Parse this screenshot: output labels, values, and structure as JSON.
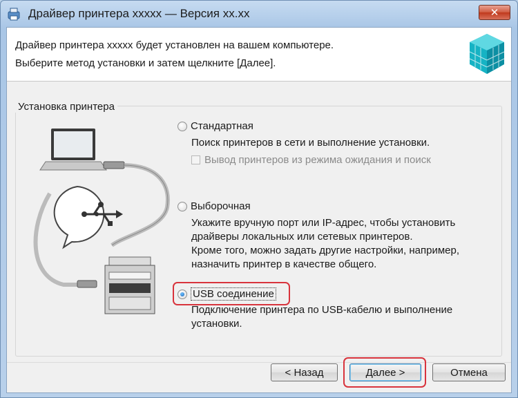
{
  "window": {
    "title": "Драйвер принтера xxxxx — Версия xx.xx",
    "close_glyph": "✕"
  },
  "header": {
    "line1": "Драйвер принтера xxxxx будет установлен на вашем компьютере.",
    "line2": "Выберите метод установки и затем щелкните [Далее]."
  },
  "group": {
    "label": "Установка принтера"
  },
  "options": [
    {
      "label": "Стандартная",
      "checked": false,
      "description": [
        "Поиск принтеров в сети и выполнение установки."
      ],
      "checkbox": {
        "label": "Вывод принтеров из режима ожидания и поиск",
        "checked": false,
        "enabled": false
      }
    },
    {
      "label": "Выборочная",
      "checked": false,
      "description": [
        "Укажите вручную порт или IP-адрес, чтобы установить",
        "драйверы локальных или сетевых принтеров.",
        "Кроме того, можно задать другие настройки, например,",
        "назначить принтер в качестве общего."
      ]
    },
    {
      "label": "USB соединение",
      "checked": true,
      "description": [
        "Подключение принтера по USB-кабелю и выполнение",
        "установки."
      ]
    }
  ],
  "buttons": {
    "back": "< Назад",
    "next": "Далее >",
    "cancel": "Отмена"
  },
  "colors": {
    "highlight": "#d8333c",
    "title_bar": "#b8d0ea"
  }
}
